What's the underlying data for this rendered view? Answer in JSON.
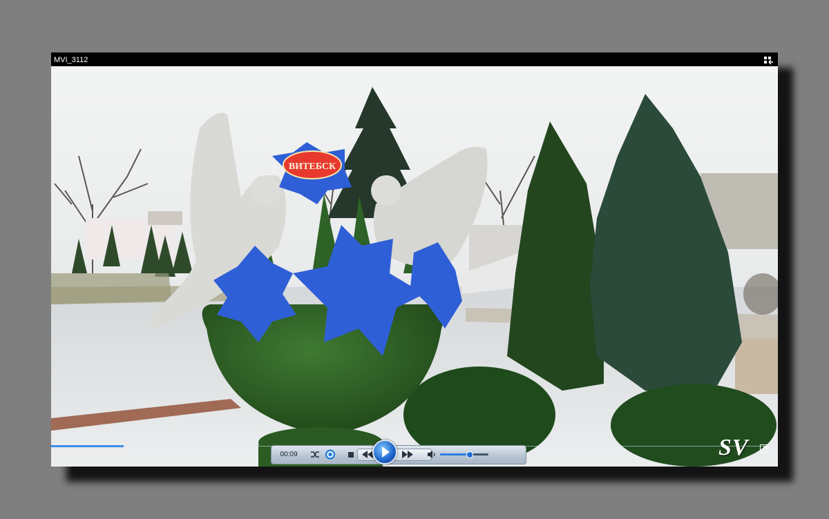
{
  "window": {
    "title": "MVI_3112"
  },
  "player": {
    "time": "00:09",
    "progress_fraction": 0.1,
    "volume_fraction": 0.6
  },
  "video": {
    "sign_text": "ВИТЕБСК"
  },
  "watermark": "SV",
  "icons": {
    "fullscreen": "fullscreen-toggle-icon",
    "shuffle": "shuffle-icon",
    "repeat": "repeat-icon",
    "stop": "stop-icon",
    "previous": "previous-icon",
    "play": "play-icon",
    "next": "next-icon",
    "volume": "speaker-icon",
    "popout": "popout-icon"
  },
  "colors": {
    "accent": "#2d7ee0",
    "cornflower": "#2f5fd6",
    "topiary": "#2c5c23",
    "sign": "#e8392f"
  }
}
